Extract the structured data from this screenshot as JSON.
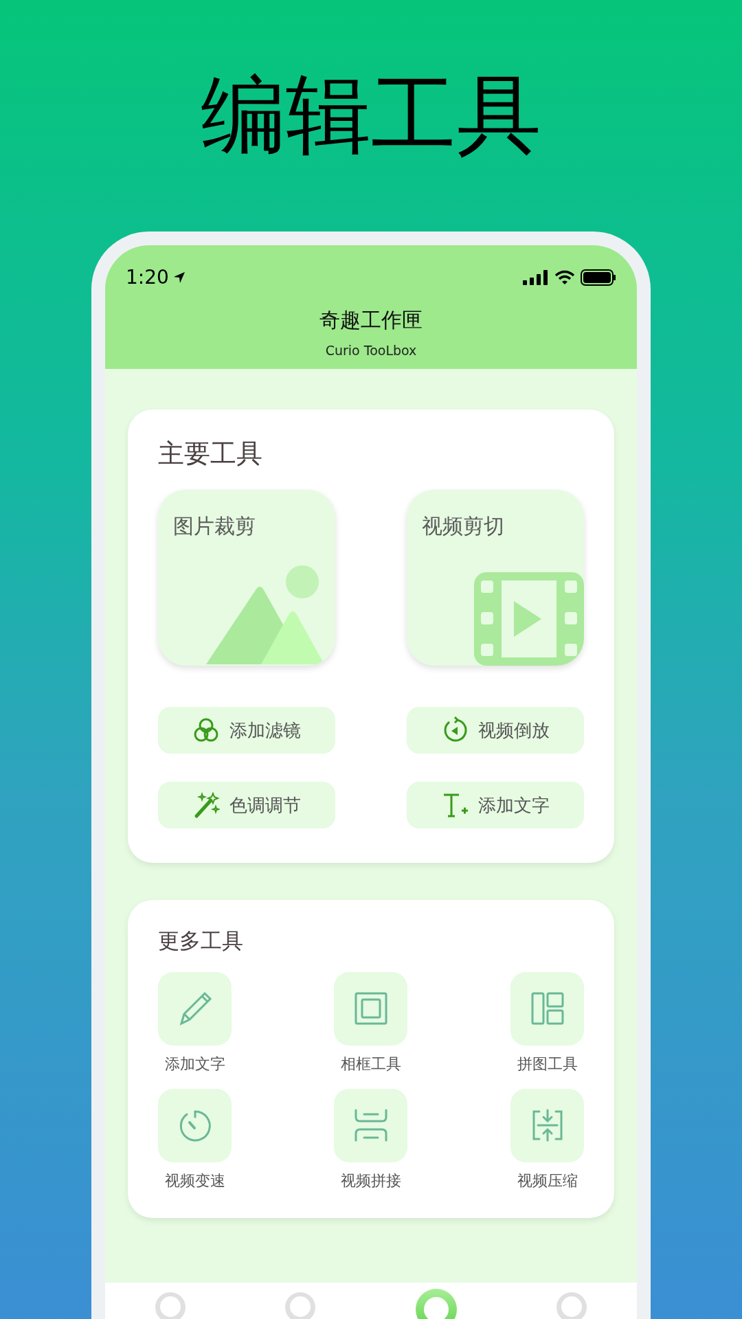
{
  "headline": "编辑工具",
  "status_bar": {
    "time": "1:20"
  },
  "header": {
    "title": "奇趣工作匣",
    "subtitle": "Curio TooLbox"
  },
  "main_tools": {
    "title": "主要工具",
    "columns": [
      {
        "tile": {
          "label": "图片裁剪",
          "kind": "photo"
        },
        "buttons": [
          {
            "label": "添加滤镜"
          },
          {
            "label": "色调调节"
          }
        ]
      },
      {
        "tile": {
          "label": "视频剪切",
          "kind": "video"
        },
        "buttons": [
          {
            "label": "视频倒放"
          },
          {
            "label": "添加文字"
          }
        ]
      }
    ]
  },
  "more_tools": {
    "title": "更多工具",
    "items": [
      {
        "label": "添加文字"
      },
      {
        "label": "相框工具"
      },
      {
        "label": "拼图工具"
      },
      {
        "label": "视频变速"
      },
      {
        "label": "视频拼接"
      },
      {
        "label": "视频压缩"
      }
    ]
  },
  "bottom_nav": [
    {
      "selected": false
    },
    {
      "selected": false
    },
    {
      "selected": true
    },
    {
      "selected": false
    }
  ]
}
